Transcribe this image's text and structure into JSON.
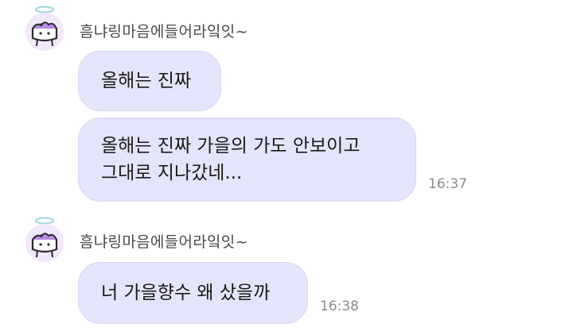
{
  "colors": {
    "bubble_background": "#e4e4fb",
    "sender_name": "#4a4a4a",
    "timestamp": "#8a8a8a",
    "avatar_accent": "#9b63d6"
  },
  "icons": {
    "avatar": "angel-cake-avatar-icon"
  },
  "groups": [
    {
      "sender": "흠냐링마음에들어라잌잇~",
      "messages": [
        {
          "lines": [
            "올해는 진짜"
          ],
          "time": ""
        },
        {
          "lines": [
            "올해는 진짜 가을의 가도 안보이고",
            "그대로 지나갔네..."
          ],
          "time": "16:37"
        }
      ]
    },
    {
      "sender": "흠냐링마음에들어라잌잇~",
      "messages": [
        {
          "lines": [
            "너 가을향수 왜 샀을까"
          ],
          "time": "16:38"
        }
      ]
    }
  ]
}
